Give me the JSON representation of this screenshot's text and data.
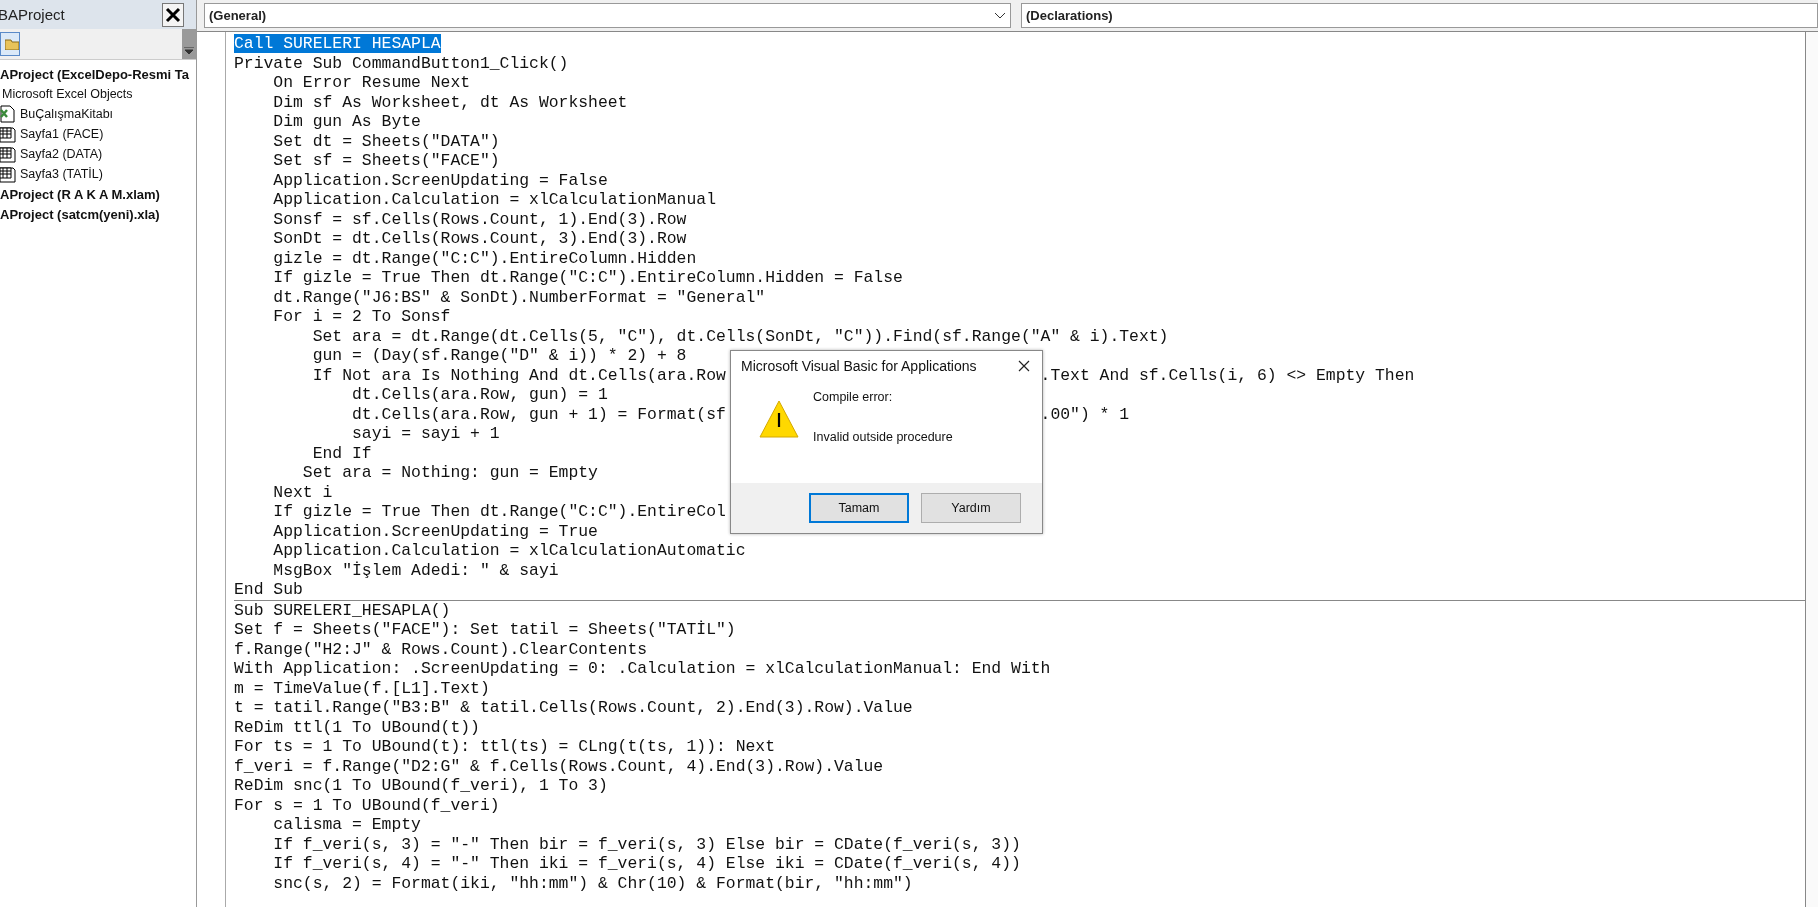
{
  "project_panel": {
    "title": "BAProject",
    "tree": [
      {
        "label": "AProject (ExcelDepo-Resmi Ta",
        "kind": "project",
        "children": [
          {
            "label": "Microsoft Excel Objects",
            "kind": "folder",
            "children": [
              {
                "label": "BuÇalışmaKitabı",
                "kind": "workbook"
              },
              {
                "label": "Sayfa1 (FACE)",
                "kind": "sheet"
              },
              {
                "label": "Sayfa2 (DATA)",
                "kind": "sheet"
              },
              {
                "label": "Sayfa3 (TATİL)",
                "kind": "sheet"
              }
            ]
          }
        ]
      },
      {
        "label": "AProject (R A K A M.xlam)",
        "kind": "project"
      },
      {
        "label": "AProject (satcm(yeni).xla)",
        "kind": "project"
      }
    ]
  },
  "object_dropdown": {
    "value": "(General)"
  },
  "procedure_dropdown": {
    "value": "(Declarations)"
  },
  "code_sections": [
    {
      "lines": [
        {
          "text": "Call SURELERI HESAPLA",
          "selected": true
        },
        {
          "text": "Private Sub CommandButton1_Click()",
          "selected": false
        },
        {
          "text": "    On Error Resume Next",
          "selected": false
        },
        {
          "text": "    Dim sf As Worksheet, dt As Worksheet",
          "selected": false
        },
        {
          "text": "    Dim gun As Byte",
          "selected": false
        },
        {
          "text": "    Set dt = Sheets(\"DATA\")",
          "selected": false
        },
        {
          "text": "    Set sf = Sheets(\"FACE\")",
          "selected": false
        },
        {
          "text": "    Application.ScreenUpdating = False",
          "selected": false
        },
        {
          "text": "    Application.Calculation = xlCalculationManual",
          "selected": false
        },
        {
          "text": "    Sonsf = sf.Cells(Rows.Count, 1).End(3).Row",
          "selected": false
        },
        {
          "text": "    SonDt = dt.Cells(Rows.Count, 3).End(3).Row",
          "selected": false
        },
        {
          "text": "    gizle = dt.Range(\"C:C\").EntireColumn.Hidden",
          "selected": false
        },
        {
          "text": "    If gizle = True Then dt.Range(\"C:C\").EntireColumn.Hidden = False",
          "selected": false
        },
        {
          "text": "    dt.Range(\"J6:BS\" & SonDt).NumberFormat = \"General\"",
          "selected": false
        },
        {
          "text": "    For i = 2 To Sonsf",
          "selected": false
        },
        {
          "text": "        Set ara = dt.Range(dt.Cells(5, \"C\"), dt.Cells(SonDt, \"C\")).Find(sf.Range(\"A\" & i).Text)",
          "selected": false
        },
        {
          "text": "        gun = (Day(sf.Range(\"D\" & i)) * 2) + 8",
          "selected": false
        },
        {
          "text": "        If Not ara Is Nothing And dt.Cells(ara.Row",
          "after": ".Text And sf.Cells(i, 6) <> Empty Then",
          "selected": false
        },
        {
          "text": "            dt.Cells(ara.Row, gun) = 1",
          "selected": false
        },
        {
          "text": "            dt.Cells(ara.Row, gun + 1) = Format(sf",
          "after": ".00\") * 1",
          "selected": false
        },
        {
          "text": "            sayi = sayi + 1",
          "selected": false
        },
        {
          "text": "        End If",
          "selected": false
        },
        {
          "text": "       Set ara = Nothing: gun = Empty",
          "selected": false
        },
        {
          "text": "    Next i",
          "selected": false
        },
        {
          "text": "    If gizle = True Then dt.Range(\"C:C\").EntireCol",
          "selected": false
        },
        {
          "text": "    Application.ScreenUpdating = True",
          "selected": false
        },
        {
          "text": "    Application.Calculation = xlCalculationAutomatic",
          "selected": false
        },
        {
          "text": "    MsgBox \"İşlem Adedi: \" & sayi",
          "selected": false
        },
        {
          "text": "End Sub",
          "selected": false
        }
      ]
    },
    {
      "lines": [
        {
          "text": "Sub SURELERI_HESAPLA()",
          "selected": false
        },
        {
          "text": "Set f = Sheets(\"FACE\"): Set tatil = Sheets(\"TATİL\")",
          "selected": false
        },
        {
          "text": "f.Range(\"H2:J\" & Rows.Count).ClearContents",
          "selected": false
        },
        {
          "text": "With Application: .ScreenUpdating = 0: .Calculation = xlCalculationManual: End With",
          "selected": false
        },
        {
          "text": "m = TimeValue(f.[L1].Text)",
          "selected": false
        },
        {
          "text": "t = tatil.Range(\"B3:B\" & tatil.Cells(Rows.Count, 2).End(3).Row).Value",
          "selected": false
        },
        {
          "text": "ReDim ttl(1 To UBound(t))",
          "selected": false
        },
        {
          "text": "For ts = 1 To UBound(t): ttl(ts) = CLng(t(ts, 1)): Next",
          "selected": false
        },
        {
          "text": "f_veri = f.Range(\"D2:G\" & f.Cells(Rows.Count, 4).End(3).Row).Value",
          "selected": false
        },
        {
          "text": "ReDim snc(1 To UBound(f_veri), 1 To 3)",
          "selected": false
        },
        {
          "text": "For s = 1 To UBound(f_veri)",
          "selected": false
        },
        {
          "text": "    calisma = Empty",
          "selected": false
        },
        {
          "text": "    If f_veri(s, 3) = \"-\" Then bir = f_veri(s, 3) Else bir = CDate(f_veri(s, 3))",
          "selected": false
        },
        {
          "text": "    If f_veri(s, 4) = \"-\" Then iki = f_veri(s, 4) Else iki = CDate(f_veri(s, 4))",
          "selected": false
        },
        {
          "text": "    snc(s, 2) = Format(iki, \"hh:mm\") & Chr(10) & Format(bir, \"hh:mm\")",
          "selected": false
        }
      ]
    }
  ],
  "dialog": {
    "title": "Microsoft Visual Basic for Applications",
    "heading": "Compile error:",
    "message": "Invalid outside procedure",
    "buttons": [
      {
        "label": "Tamam",
        "focused": true
      },
      {
        "label": "Yardım",
        "focused": false
      }
    ]
  }
}
